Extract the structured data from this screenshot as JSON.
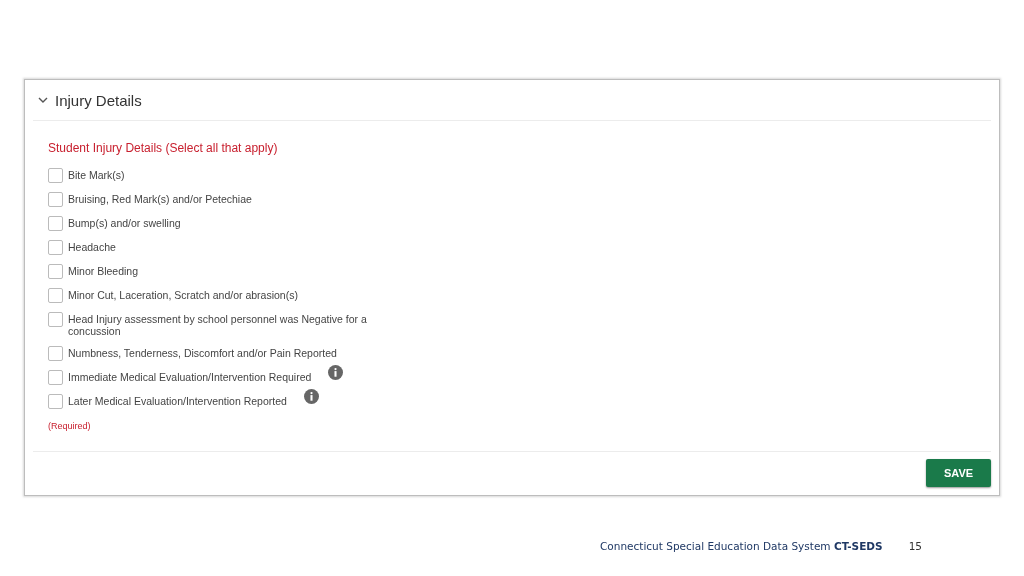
{
  "panel": {
    "title": "Injury Details",
    "expanded": true,
    "question": "Student Injury Details (Select all that apply)",
    "options": [
      {
        "label": "Bite Mark(s)",
        "checked": false,
        "info": false
      },
      {
        "label": "Bruising, Red Mark(s) and/or Petechiae",
        "checked": false,
        "info": false
      },
      {
        "label": "Bump(s) and/or swelling",
        "checked": false,
        "info": false
      },
      {
        "label": "Headache",
        "checked": false,
        "info": false
      },
      {
        "label": "Minor Bleeding",
        "checked": false,
        "info": false
      },
      {
        "label": "Minor Cut, Laceration, Scratch and/or abrasion(s)",
        "checked": false,
        "info": false
      },
      {
        "label": "Head Injury assessment by school personnel was Negative for a concussion",
        "checked": false,
        "info": false
      },
      {
        "label": "Numbness, Tenderness, Discomfort and/or Pain Reported",
        "checked": false,
        "info": false
      },
      {
        "label": "Immediate Medical Evaluation/Intervention Required",
        "checked": false,
        "info": true
      },
      {
        "label": "Later Medical Evaluation/Intervention Reported",
        "checked": false,
        "info": true
      }
    ],
    "required_note": "(Required)",
    "save_button": "SAVE"
  },
  "footer": {
    "text": "Connecticut Special Education Data System **CT-SEDS**",
    "page_number": "15"
  }
}
